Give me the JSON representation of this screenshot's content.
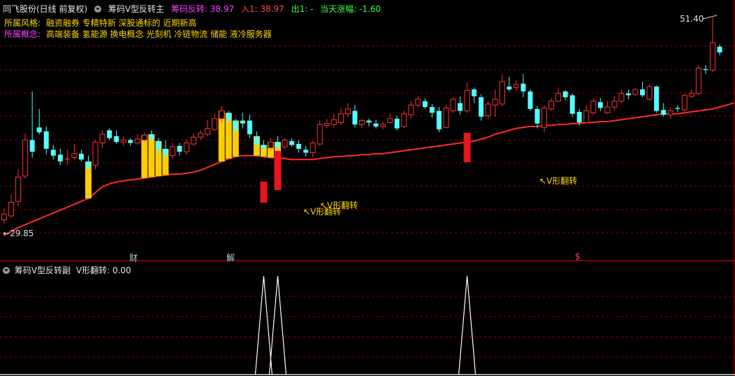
{
  "header": {
    "stock_title": "同飞股份(日线 前复权)",
    "indicator_name": "筹码V型反转主",
    "line1_label": "筹码反转: 38.97",
    "line2_label": "入1: 38.97",
    "line3_label": "出1: -",
    "line4_label": "当天涨幅: -1.60"
  },
  "info": {
    "style_label": "所属风格:",
    "style_value": "融资融券 专精特新 深股通标的 近期新高",
    "concept_label": "所属概念:",
    "concept_value": "高端装备 氢能源 换电概念 光刻机 冷链物流 储能 液冷服务器"
  },
  "price_labels": {
    "high": "51.40",
    "low": "29.85"
  },
  "signal_labels": {
    "v1": "V形翻转",
    "v2": "V形翻转",
    "v3": "V形翻转"
  },
  "event_markers": {
    "m1": "财",
    "m2": "解",
    "m3": "$"
  },
  "sub_panel": {
    "indicator_name": "筹码V型反转副",
    "value_label": "V形翻转: 0.00"
  },
  "colors": {
    "up": "#ff3232",
    "down": "#54ffff",
    "ma": "#ff2a2a",
    "grid": "#8b0000",
    "highlight": "#ffcc00",
    "magenta": "#ff40ff"
  },
  "chart_data": {
    "type": "candlestick",
    "price_range": [
      29.85,
      51.4
    ],
    "candles": [
      {
        "o": 30.6,
        "c": 31.2,
        "h": 31.8,
        "l": 30.2
      },
      {
        "o": 31.0,
        "c": 32.4,
        "h": 33.2,
        "l": 30.8
      },
      {
        "o": 32.5,
        "c": 35.0,
        "h": 35.8,
        "l": 32.0
      },
      {
        "o": 35.1,
        "c": 38.8,
        "h": 39.5,
        "l": 34.8
      },
      {
        "o": 38.8,
        "c": 37.6,
        "h": 43.8,
        "l": 37.0
      },
      {
        "o": 40.1,
        "c": 39.6,
        "h": 42.0,
        "l": 39.4
      },
      {
        "o": 39.7,
        "c": 37.9,
        "h": 40.2,
        "l": 37.3
      },
      {
        "o": 37.8,
        "c": 37.2,
        "h": 38.3,
        "l": 36.8
      },
      {
        "o": 37.3,
        "c": 36.6,
        "h": 37.9,
        "l": 36.2
      },
      {
        "o": 36.8,
        "c": 36.9,
        "h": 37.8,
        "l": 36.2
      },
      {
        "o": 37.0,
        "c": 37.4,
        "h": 38.4,
        "l": 36.8
      },
      {
        "o": 37.4,
        "c": 36.8,
        "h": 37.8,
        "l": 36.6
      },
      {
        "o": 36.6,
        "c": 36.0,
        "h": 37.2,
        "l": 35.6
      },
      {
        "o": 36.2,
        "c": 38.6,
        "h": 38.8,
        "l": 35.8
      },
      {
        "o": 38.5,
        "c": 39.4,
        "h": 39.8,
        "l": 38.0
      },
      {
        "o": 39.8,
        "c": 39.0,
        "h": 40.0,
        "l": 38.8
      },
      {
        "o": 39.2,
        "c": 38.6,
        "h": 39.8,
        "l": 38.4
      },
      {
        "o": 38.6,
        "c": 38.8,
        "h": 39.2,
        "l": 38.2
      },
      {
        "o": 38.8,
        "c": 38.5,
        "h": 39.0,
        "l": 38.2
      },
      {
        "o": 38.5,
        "c": 38.9,
        "h": 39.4,
        "l": 38.3
      },
      {
        "o": 38.8,
        "c": 39.3,
        "h": 39.6,
        "l": 38.6
      },
      {
        "o": 39.4,
        "c": 38.9,
        "h": 39.8,
        "l": 38.7
      },
      {
        "o": 38.7,
        "c": 37.8,
        "h": 39.0,
        "l": 37.4
      },
      {
        "o": 37.9,
        "c": 37.2,
        "h": 38.8,
        "l": 36.8
      },
      {
        "o": 37.2,
        "c": 38.1,
        "h": 38.5,
        "l": 36.9
      },
      {
        "o": 38.2,
        "c": 37.6,
        "h": 38.5,
        "l": 37.2
      },
      {
        "o": 37.6,
        "c": 38.5,
        "h": 38.8,
        "l": 37.3
      },
      {
        "o": 38.4,
        "c": 39.1,
        "h": 39.5,
        "l": 38.2
      },
      {
        "o": 39.1,
        "c": 39.5,
        "h": 39.8,
        "l": 38.8
      },
      {
        "o": 39.4,
        "c": 40.0,
        "h": 40.9,
        "l": 39.2
      },
      {
        "o": 39.9,
        "c": 41.0,
        "h": 41.5,
        "l": 39.7
      },
      {
        "o": 41.0,
        "c": 41.8,
        "h": 42.3,
        "l": 40.6
      },
      {
        "o": 41.6,
        "c": 40.8,
        "h": 41.8,
        "l": 40.5
      },
      {
        "o": 40.8,
        "c": 39.8,
        "h": 41.0,
        "l": 39.5
      },
      {
        "o": 40.8,
        "c": 40.5,
        "h": 41.6,
        "l": 40.0
      },
      {
        "o": 40.8,
        "c": 39.4,
        "h": 41.4,
        "l": 39.0
      },
      {
        "o": 39.2,
        "c": 38.4,
        "h": 39.7,
        "l": 38.0
      },
      {
        "o": 38.3,
        "c": 38.0,
        "h": 38.8,
        "l": 37.6
      },
      {
        "o": 38.0,
        "c": 38.6,
        "h": 39.0,
        "l": 37.8
      },
      {
        "o": 38.6,
        "c": 38.1,
        "h": 39.2,
        "l": 37.8
      },
      {
        "o": 38.1,
        "c": 38.8,
        "h": 39.0,
        "l": 37.9
      },
      {
        "o": 38.7,
        "c": 38.3,
        "h": 39.0,
        "l": 38.1
      },
      {
        "o": 38.4,
        "c": 37.9,
        "h": 38.8,
        "l": 37.5
      },
      {
        "o": 37.8,
        "c": 37.5,
        "h": 38.2,
        "l": 37.1
      },
      {
        "o": 37.5,
        "c": 38.5,
        "h": 38.7,
        "l": 37.0
      },
      {
        "o": 38.4,
        "c": 40.4,
        "h": 40.8,
        "l": 38.2
      },
      {
        "o": 40.3,
        "c": 40.5,
        "h": 41.0,
        "l": 40.0
      },
      {
        "o": 40.4,
        "c": 40.9,
        "h": 41.5,
        "l": 40.0
      },
      {
        "o": 40.6,
        "c": 41.5,
        "h": 42.1,
        "l": 40.4
      },
      {
        "o": 41.5,
        "c": 42.0,
        "h": 42.6,
        "l": 41.2
      },
      {
        "o": 41.8,
        "c": 40.4,
        "h": 42.4,
        "l": 40.1
      },
      {
        "o": 40.4,
        "c": 40.8,
        "h": 41.0,
        "l": 40.0
      },
      {
        "o": 40.8,
        "c": 40.6,
        "h": 41.0,
        "l": 40.2
      },
      {
        "o": 40.5,
        "c": 40.2,
        "h": 40.9,
        "l": 40.0
      },
      {
        "o": 40.2,
        "c": 40.4,
        "h": 40.7,
        "l": 39.9
      },
      {
        "o": 40.6,
        "c": 41.0,
        "h": 41.6,
        "l": 40.5
      },
      {
        "o": 41.0,
        "c": 40.0,
        "h": 41.3,
        "l": 39.8
      },
      {
        "o": 40.2,
        "c": 41.5,
        "h": 41.8,
        "l": 40.0
      },
      {
        "o": 41.4,
        "c": 42.4,
        "h": 42.8,
        "l": 41.0
      },
      {
        "o": 42.4,
        "c": 43.0,
        "h": 43.3,
        "l": 42.1
      },
      {
        "o": 42.8,
        "c": 42.2,
        "h": 43.1,
        "l": 42.0
      },
      {
        "o": 42.2,
        "c": 41.6,
        "h": 42.5,
        "l": 41.1
      },
      {
        "o": 41.8,
        "c": 39.9,
        "h": 42.2,
        "l": 39.6
      },
      {
        "o": 40.1,
        "c": 42.1,
        "h": 42.4,
        "l": 40.0
      },
      {
        "o": 41.8,
        "c": 43.0,
        "h": 43.2,
        "l": 41.6
      },
      {
        "o": 42.6,
        "c": 41.8,
        "h": 43.3,
        "l": 41.4
      },
      {
        "o": 41.8,
        "c": 43.9,
        "h": 44.7,
        "l": 41.6
      },
      {
        "o": 44.0,
        "c": 43.3,
        "h": 44.2,
        "l": 42.6
      },
      {
        "o": 43.2,
        "c": 41.2,
        "h": 43.5,
        "l": 40.8
      },
      {
        "o": 41.3,
        "c": 42.5,
        "h": 42.8,
        "l": 41.0
      },
      {
        "o": 42.4,
        "c": 43.0,
        "h": 44.0,
        "l": 41.2
      },
      {
        "o": 42.5,
        "c": 44.8,
        "h": 45.5,
        "l": 42.3
      },
      {
        "o": 44.3,
        "c": 44.0,
        "h": 45.3,
        "l": 43.8
      },
      {
        "o": 44.2,
        "c": 44.5,
        "h": 45.0,
        "l": 43.9
      },
      {
        "o": 44.6,
        "c": 43.8,
        "h": 45.6,
        "l": 43.2
      },
      {
        "o": 43.8,
        "c": 42.0,
        "h": 44.0,
        "l": 41.8
      },
      {
        "o": 42.0,
        "c": 40.5,
        "h": 42.3,
        "l": 40.0
      },
      {
        "o": 40.1,
        "c": 42.1,
        "h": 42.4,
        "l": 39.6
      },
      {
        "o": 42.0,
        "c": 42.8,
        "h": 43.1,
        "l": 41.8
      },
      {
        "o": 42.8,
        "c": 43.6,
        "h": 44.2,
        "l": 42.7
      },
      {
        "o": 43.8,
        "c": 43.2,
        "h": 43.9,
        "l": 42.9
      },
      {
        "o": 43.4,
        "c": 41.5,
        "h": 43.6,
        "l": 41.2
      },
      {
        "o": 41.7,
        "c": 40.6,
        "h": 42.0,
        "l": 40.3
      },
      {
        "o": 40.6,
        "c": 41.8,
        "h": 42.4,
        "l": 40.5
      },
      {
        "o": 41.6,
        "c": 42.8,
        "h": 43.1,
        "l": 41.4
      },
      {
        "o": 42.7,
        "c": 42.1,
        "h": 43.1,
        "l": 41.8
      },
      {
        "o": 41.6,
        "c": 42.2,
        "h": 42.8,
        "l": 41.5
      },
      {
        "o": 42.2,
        "c": 42.8,
        "h": 43.3,
        "l": 41.8
      },
      {
        "o": 42.8,
        "c": 43.6,
        "h": 44.0,
        "l": 42.6
      },
      {
        "o": 43.6,
        "c": 43.4,
        "h": 44.0,
        "l": 43.0
      },
      {
        "o": 43.5,
        "c": 44.0,
        "h": 44.2,
        "l": 43.3
      },
      {
        "o": 44.0,
        "c": 43.4,
        "h": 44.8,
        "l": 43.2
      },
      {
        "o": 43.0,
        "c": 44.3,
        "h": 44.5,
        "l": 42.8
      },
      {
        "o": 44.3,
        "c": 41.8,
        "h": 44.4,
        "l": 41.6
      },
      {
        "o": 41.9,
        "c": 41.4,
        "h": 42.6,
        "l": 41.2
      },
      {
        "o": 41.4,
        "c": 41.8,
        "h": 42.1,
        "l": 41.0
      },
      {
        "o": 42.1,
        "c": 42.0,
        "h": 42.4,
        "l": 41.7
      },
      {
        "o": 41.9,
        "c": 43.4,
        "h": 43.6,
        "l": 41.7
      },
      {
        "o": 43.3,
        "c": 43.6,
        "h": 44.0,
        "l": 43.1
      },
      {
        "o": 43.6,
        "c": 46.2,
        "h": 46.5,
        "l": 43.4
      },
      {
        "o": 46.1,
        "c": 46.0,
        "h": 46.5,
        "l": 45.6
      },
      {
        "o": 46.0,
        "c": 48.8,
        "h": 51.4,
        "l": 45.8
      },
      {
        "o": 48.4,
        "c": 47.8,
        "h": 48.6,
        "l": 47.5
      }
    ],
    "ma": [
      29.0,
      29.4,
      29.8,
      30.1,
      30.4,
      30.7,
      31.0,
      31.3,
      31.6,
      31.9,
      32.2,
      32.5,
      32.8,
      33.4,
      34.0,
      34.3,
      34.5,
      34.6,
      34.7,
      34.8,
      34.9,
      35.0,
      35.1,
      35.2,
      35.3,
      35.3,
      35.4,
      35.5,
      35.7,
      36.0,
      36.3,
      36.6,
      36.9,
      37.1,
      37.2,
      37.2,
      37.2,
      37.1,
      37.0,
      37.0,
      36.9,
      36.8,
      36.8,
      36.8,
      36.8,
      36.9,
      37.0,
      37.1,
      37.1,
      37.2,
      37.2,
      37.3,
      37.3,
      37.4,
      37.4,
      37.5,
      37.6,
      37.7,
      37.8,
      37.9,
      38.0,
      38.1,
      38.2,
      38.3,
      38.4,
      38.5,
      38.6,
      38.7,
      38.9,
      39.1,
      39.4,
      39.6,
      39.8,
      40.0,
      40.1,
      40.2,
      40.2,
      40.3,
      40.3,
      40.4,
      40.4,
      40.5,
      40.5,
      40.6,
      40.6,
      40.7,
      40.7,
      40.8,
      40.9,
      41.0,
      41.1,
      41.2,
      41.3,
      41.4,
      41.5,
      41.5,
      41.5,
      41.6,
      41.7,
      41.8,
      41.9,
      42.0,
      42.2,
      42.4,
      42.6
    ],
    "sub_signals": [
      {
        "index": 37,
        "value": 1
      },
      {
        "index": 39,
        "value": 1
      },
      {
        "index": 66,
        "value": 1
      }
    ]
  }
}
